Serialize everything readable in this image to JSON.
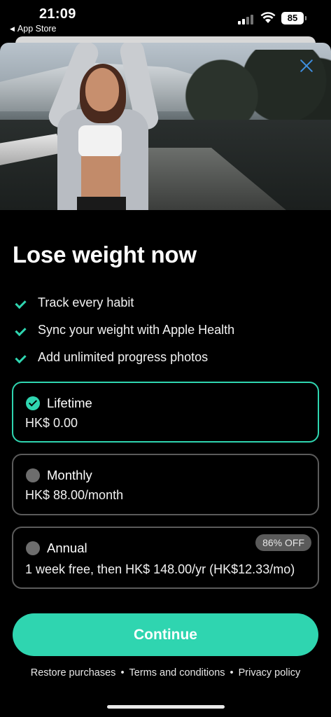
{
  "status_bar": {
    "time": "21:09",
    "back_app": "App Store",
    "battery": "85"
  },
  "hero": {
    "image_description_icon": "woman-stretching-photo"
  },
  "paywall": {
    "title": "Lose weight now",
    "features": [
      "Track every habit",
      "Sync your weight with Apple Health",
      "Add unlimited progress photos"
    ],
    "plans": [
      {
        "name": "Lifetime",
        "price": "HK$ 0.00",
        "selected": true
      },
      {
        "name": "Monthly",
        "price": "HK$ 88.00/month",
        "selected": false
      },
      {
        "name": "Annual",
        "price": "1 week free, then HK$ 148.00/yr (HK$12.33/mo)",
        "badge": "86% OFF",
        "selected": false
      }
    ],
    "continue_label": "Continue",
    "footer": {
      "restore": "Restore purchases",
      "terms": "Terms and conditions",
      "privacy": "Privacy policy",
      "separator": "•"
    }
  },
  "colors": {
    "accent": "#2fd5b0",
    "background": "#000000",
    "close_icon": "#3f8fe0"
  }
}
